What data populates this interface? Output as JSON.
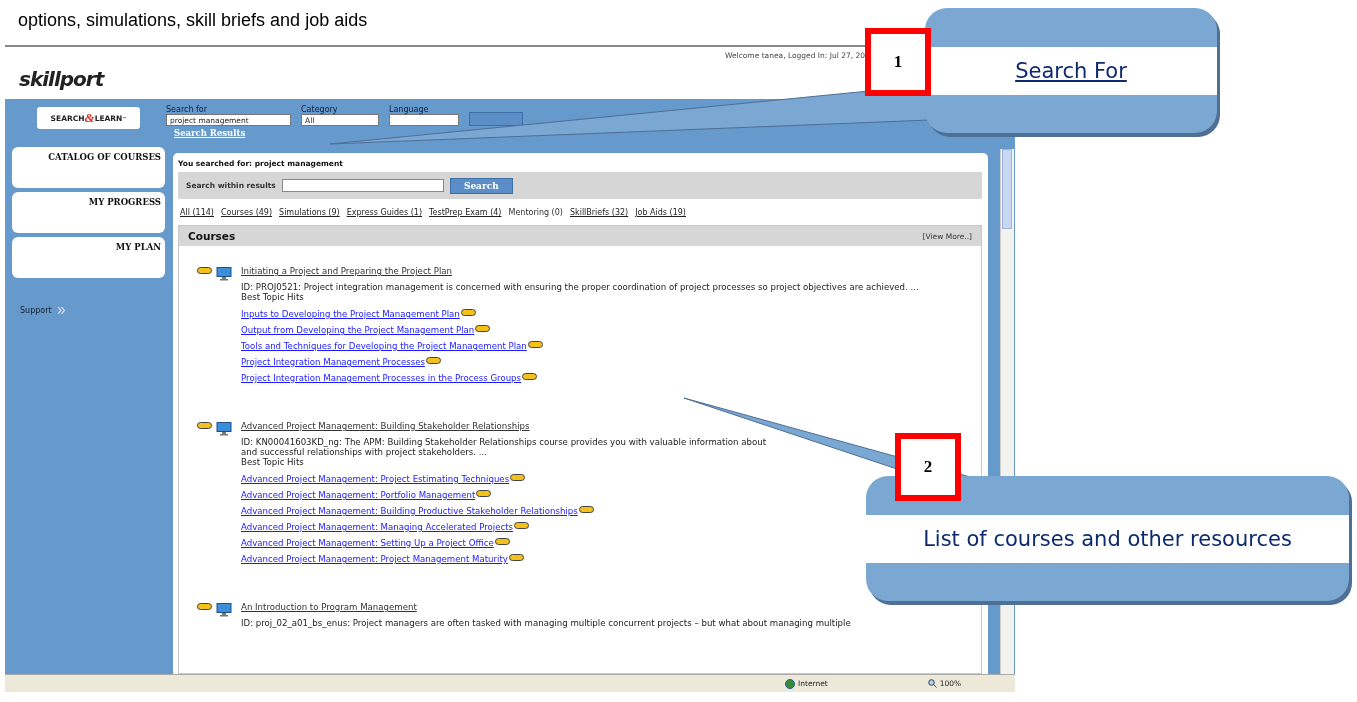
{
  "document": {
    "caption": "options, simulations, skill briefs and job aids"
  },
  "header": {
    "logo": "skillport",
    "welcome": "Welcome tanea, Logged In: Jul 27, 20"
  },
  "search_bar": {
    "badge": {
      "left": "SEARCH",
      "middle": "&",
      "right": "LEARN",
      "mark": "™"
    },
    "fields": [
      {
        "label": "Search for",
        "value": "project management",
        "kind": "text"
      },
      {
        "label": "Category",
        "value": "All",
        "kind": "select"
      },
      {
        "label": "Language",
        "kind": "select"
      }
    ]
  },
  "breadcrumb": "Search Results",
  "sidebar": {
    "items": [
      {
        "label": "CATALOG OF COURSES"
      },
      {
        "label": "MY PROGRESS"
      },
      {
        "label": "MY PLAN"
      }
    ],
    "support": "Support"
  },
  "results": {
    "query_prefix": "You searched for:",
    "query": "project management",
    "within": {
      "label": "Search within results",
      "button": "Search"
    },
    "filters": [
      {
        "label": "All (114)",
        "disabled": false
      },
      {
        "label": "Courses (49)",
        "disabled": false
      },
      {
        "label": "Simulations (9)",
        "disabled": false
      },
      {
        "label": "Express Guides (1)",
        "disabled": false
      },
      {
        "label": "TestPrep Exam (4)",
        "disabled": false
      },
      {
        "label": "Mentoring (0)",
        "disabled": true
      },
      {
        "label": "SkillBriefs (32)",
        "disabled": false
      },
      {
        "label": "Job Aids (19)",
        "disabled": false
      }
    ],
    "section": {
      "title": "Courses",
      "more": "[View More..]"
    },
    "courses": [
      {
        "title": "Initiating a Project and Preparing the Project Plan",
        "description": "ID: PROJ0521: Project integration management is concerned with ensuring the proper coordination of project processes so project objectives are achieved. ...",
        "hits_label": "Best Topic Hits",
        "topics": [
          "Inputs to Developing the Project Management Plan",
          "Output from Developing the Project Management Plan",
          "Tools and Techniques for Developing the Project Management Plan",
          "Project Integration Management Processes",
          "Project Integration Management Processes in the Process Groups"
        ]
      },
      {
        "title": "Advanced Project Management: Building Stakeholder Relationships",
        "description": "ID: KN00041603KD_ng: The APM: Building Stakeholder Relationships course provides you with valuable information about",
        "description_2": "and successful relationships with project stakeholders. ...",
        "hits_label": "Best Topic Hits",
        "topics": [
          "Advanced Project Management: Project Estimating Techniques",
          "Advanced Project Management: Portfolio Management",
          "Advanced Project Management: Building Productive Stakeholder Relationships",
          "Advanced Project Management: Managing Accelerated Projects",
          "Advanced Project Management: Setting Up a Project Office",
          "Advanced Project Management: Project Management Maturity"
        ]
      },
      {
        "title": "An Introduction to Program Management",
        "description": "ID: proj_02_a01_bs_enus: Project managers are often tasked with managing multiple concurrent projects – but what about managing multiple"
      }
    ]
  },
  "status_bar": {
    "zone": "Internet",
    "zoom": "100%"
  },
  "callouts": [
    {
      "number": "1",
      "text": "Search For",
      "kind": "link"
    },
    {
      "number": "2",
      "text": "List of courses and other resources",
      "kind": "plain"
    }
  ]
}
